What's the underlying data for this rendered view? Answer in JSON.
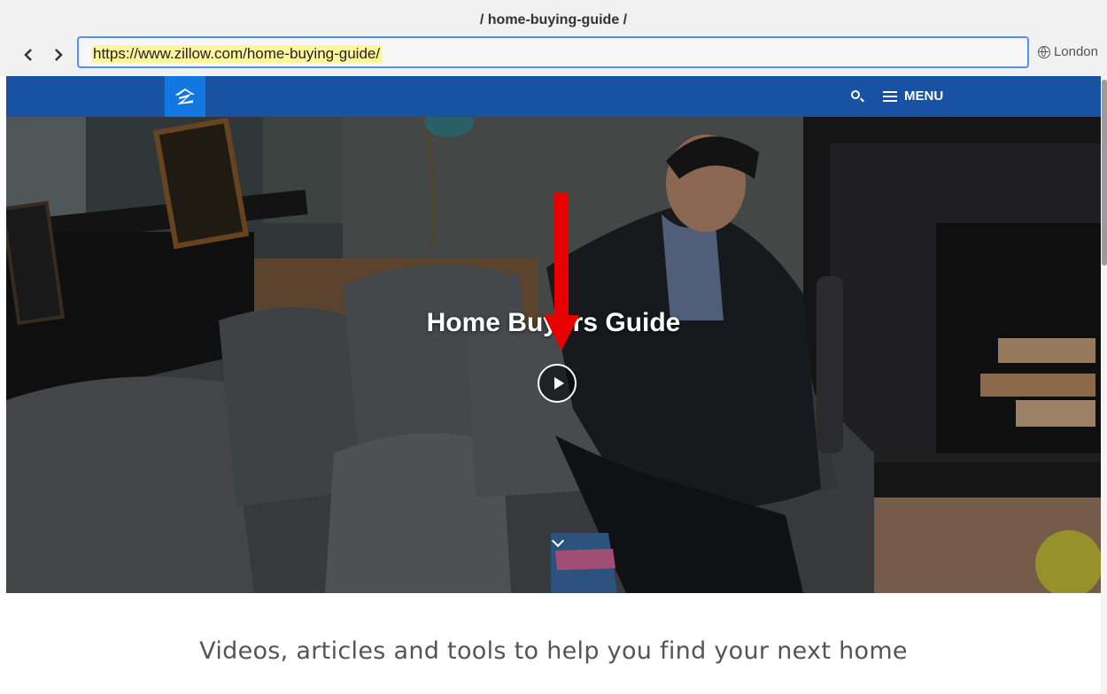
{
  "window": {
    "title": "/ home-buying-guide /"
  },
  "browser": {
    "url": "https://www.zillow.com/home-buying-guide/",
    "locale": "London",
    "back_icon": "chevron-left-icon",
    "forward_icon": "chevron-right-icon"
  },
  "header": {
    "logo_icon": "zillow-logo-icon",
    "menu_label": "MENU",
    "brand_color": "#1a52a3",
    "logo_color": "#1277e1"
  },
  "hero": {
    "title": "Home Buyers Guide",
    "play_icon": "play-icon",
    "scroll_icon": "chevron-down-icon",
    "annotation": "red-arrow-icon",
    "annotation_color": "#e60000"
  },
  "main": {
    "tagline": "Videos, articles and tools to help you find your next home"
  }
}
